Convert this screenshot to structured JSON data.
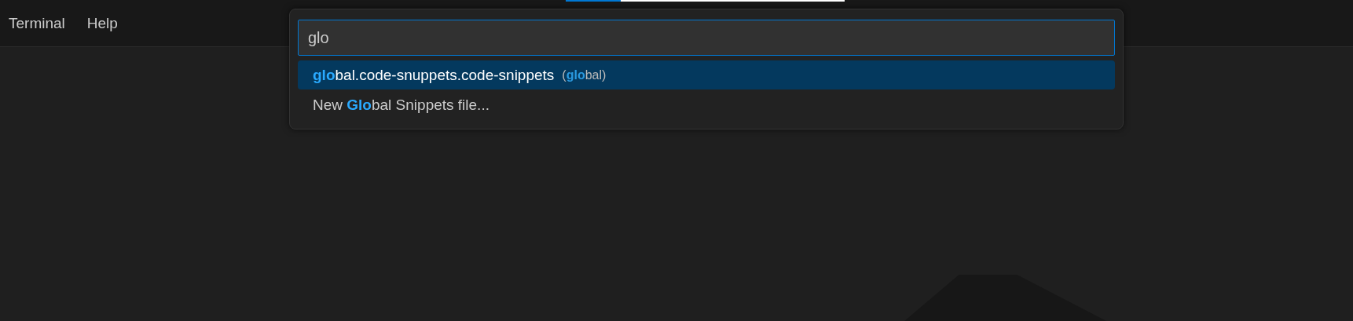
{
  "menu_bar": {
    "items": [
      {
        "label": "Terminal"
      },
      {
        "label": "Help"
      }
    ]
  },
  "quick_pick": {
    "value": "glo",
    "items": [
      {
        "label": "**glo**bal.code-snuppets.code-snippets",
        "description": "(**glo**bal)",
        "selected": true
      },
      {
        "label": "New **Glo**bal Snippets file...",
        "selected": false
      }
    ]
  }
}
